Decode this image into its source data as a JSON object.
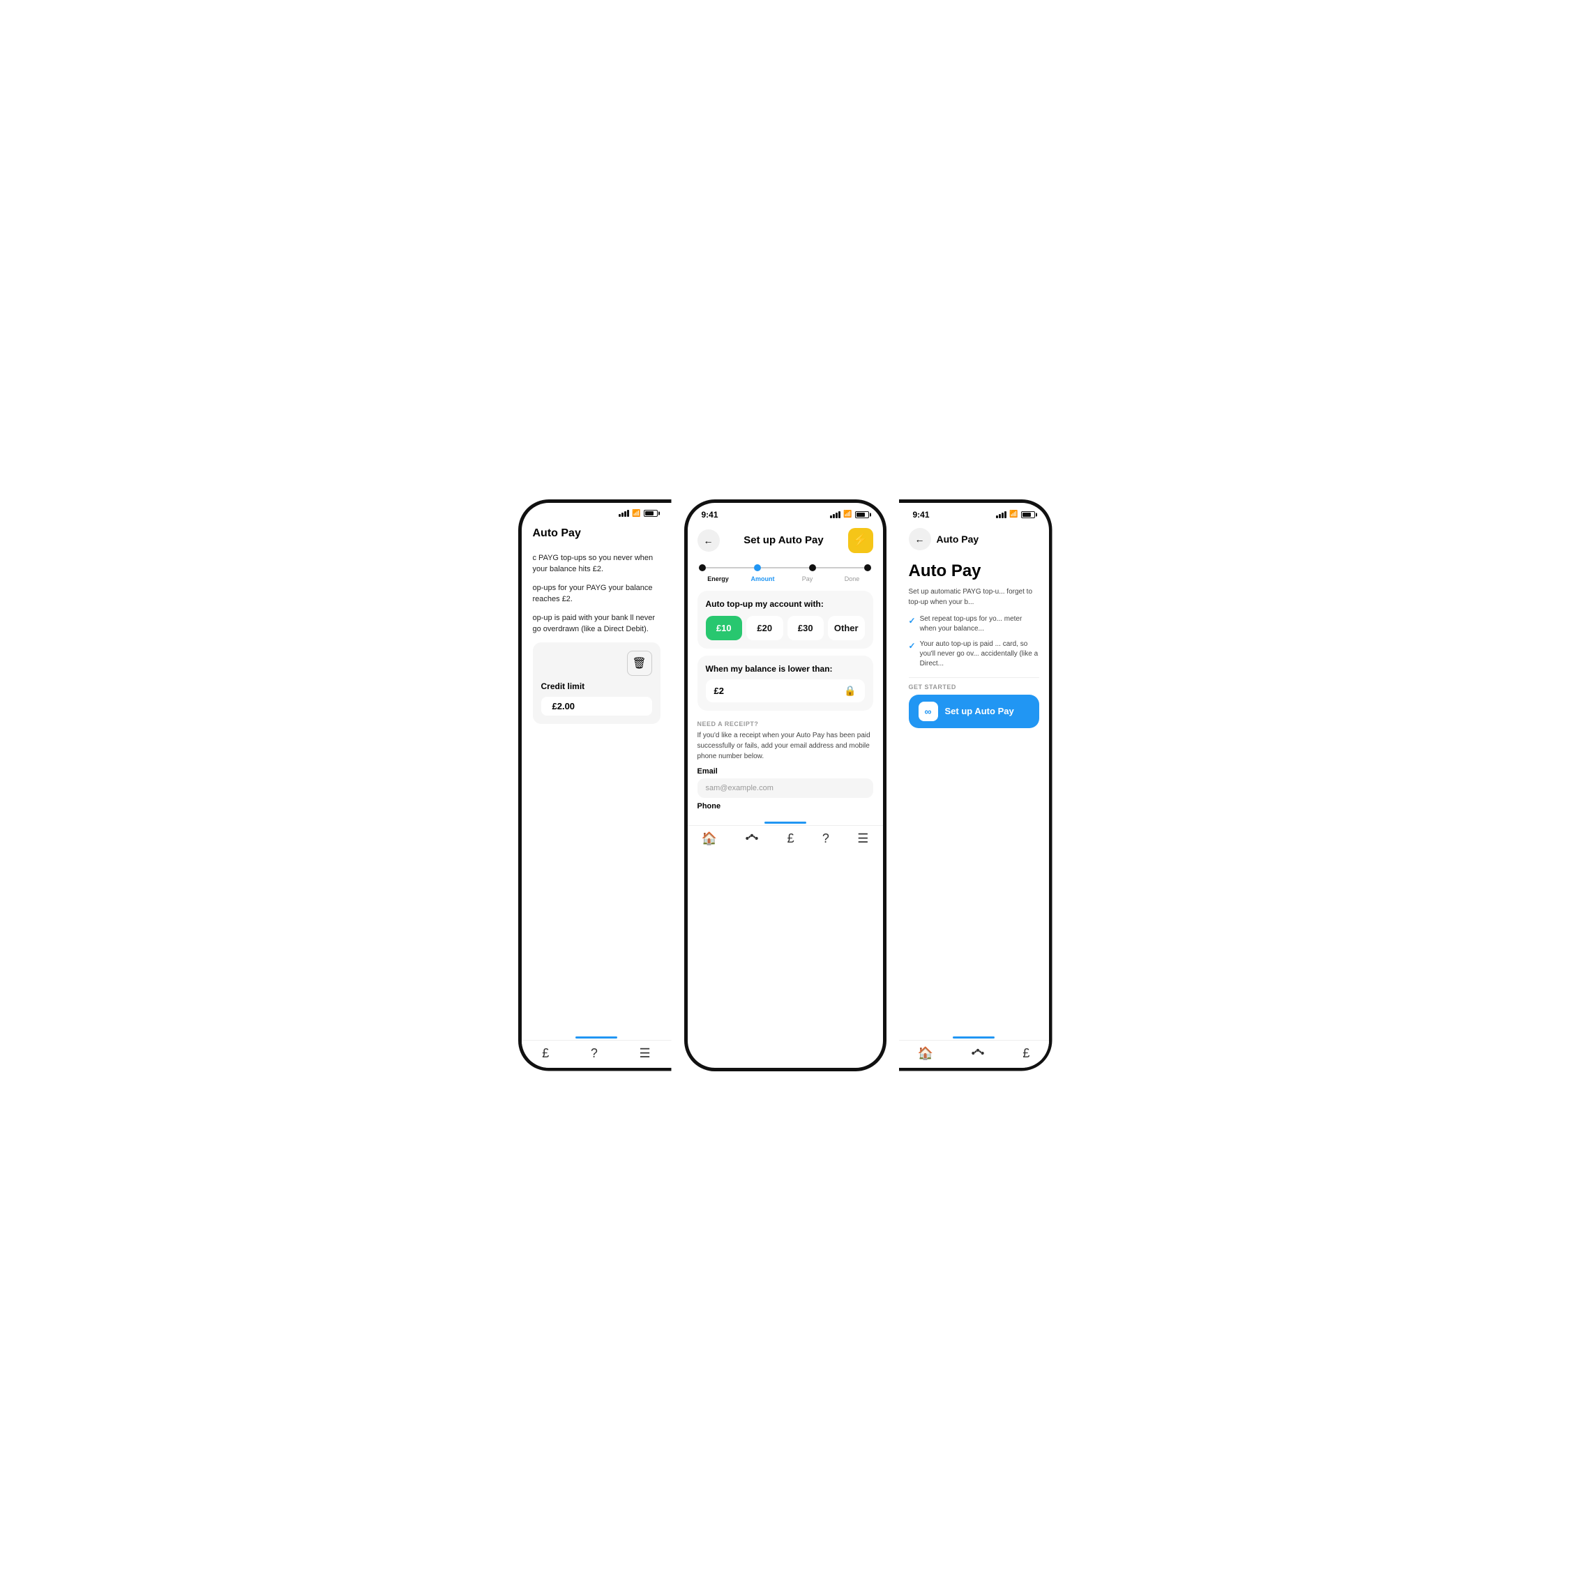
{
  "left_phone": {
    "header_title": "Auto Pay",
    "body_text_1": "c PAYG top-ups so you never when your balance hits £2.",
    "body_text_2": "op-ups for your PAYG your balance reaches £2.",
    "body_text_3": "op-up is paid with your bank ll never go overdrawn (like a Direct Debit).",
    "credit_limit_label": "Credit limit",
    "credit_limit_value": "£2.00",
    "nav_items": [
      "£",
      "?",
      "☰"
    ]
  },
  "center_phone": {
    "status_time": "9:41",
    "header_title": "Set up Auto Pay",
    "back_label": "←",
    "lightning_icon": "⚡",
    "stepper": {
      "steps": [
        "Energy",
        "Amount",
        "Pay",
        "Done"
      ],
      "active_index": 1
    },
    "amount_card": {
      "title": "Auto top-up my account with:",
      "options": [
        "£10",
        "£20",
        "£30",
        "Other"
      ],
      "selected_index": 0
    },
    "balance_card": {
      "title": "When my balance is lower than:",
      "value": "£2"
    },
    "receipt_section": {
      "label": "NEED A RECEIPT?",
      "description": "If you'd like a receipt when your Auto Pay has been paid successfully or fails, add your email address and mobile phone number below.",
      "email_label": "Email",
      "email_placeholder": "sam@example.com",
      "phone_label": "Phone"
    },
    "nav_items": [
      "🏠",
      "⬡",
      "£",
      "?",
      "☰"
    ]
  },
  "right_phone": {
    "status_time": "9:41",
    "header_title": "Auto Pay",
    "back_label": "←",
    "page_title": "Auto Pay",
    "description": "Set up automatic PAYG top-u... forget to top-up when your b...",
    "bullets": [
      "Set repeat top-ups for yo... meter when your balance...",
      "Your auto top-up is paid ... card, so you'll never go ov... accidentally (like a Direct..."
    ],
    "get_started_label": "GET STARTED",
    "setup_btn_label": "Set up Auto Pay",
    "nav_items": [
      "🏠",
      "⬡",
      "£"
    ]
  }
}
